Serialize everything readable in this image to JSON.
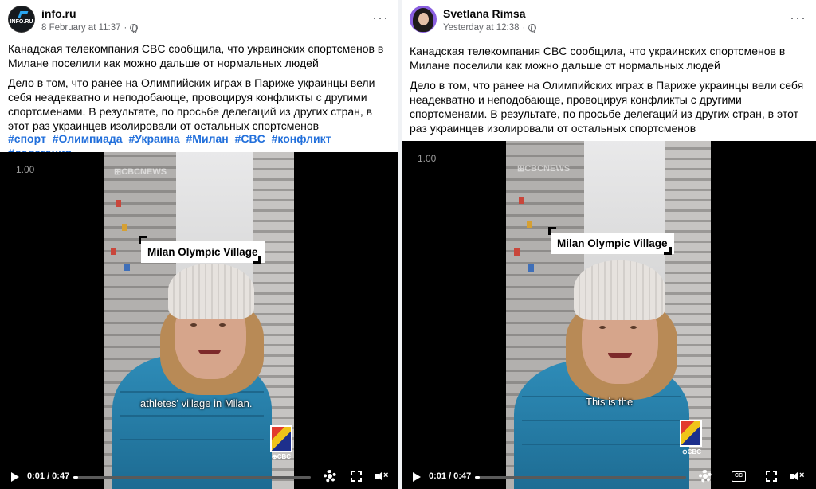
{
  "posts": [
    {
      "author": "info.ru",
      "avatar_text": "INFO.RU",
      "time": "8 February at 11:37",
      "paragraph1": "Канадская телекомпания CBC сообщила, что украинских спортсменов в Милане поселили как можно дальше от нормальных людей",
      "paragraph2": "Дело в том, что ранее на Олимпийских играх в Париже украинцы вели себя неадекватно и неподобающе, провоцируя конфликты с другими спортсменами. В результате, по просьбе делегаций из других стран, в этот раз украинцев изолировали от остальных спортсменов",
      "hashtags": [
        "#спорт",
        "#Олимпиада",
        "#Украина",
        "#Милан",
        "#CBC",
        "#конфликт",
        "#делегация"
      ],
      "video": {
        "rate": "1.00",
        "watermark": "⊞CBCNEWS",
        "location_label": "Milan Olympic Village",
        "subtitle": "athletes' village in Milan.",
        "logo_text": "⊕CBC",
        "time": "0:01 / 0:47",
        "progress": 0.021
      }
    },
    {
      "author": "Svetlana Rimsa",
      "time": "Yesterday at 12:38",
      "paragraph1": "Канадская телекомпания CBC сообщила, что украинских спортсменов в Милане поселили как можно дальше от нормальных людей",
      "paragraph2": "Дело в том, что ранее на Олимпийских играх в Париже украинцы вели себя неадекватно и неподобающе, провоцируя конфликты с другими спортсменами. В результате, по просьбе делегаций из других стран, в этот раз украинцев изолировали от остальных спортсменов",
      "video": {
        "rate": "1.00",
        "watermark": "⊞CBCNEWS",
        "location_label": "Milan Olympic Village",
        "subtitle": "This is the",
        "logo_text": "⊕CBC",
        "time": "0:01 / 0:47",
        "progress": 0.021,
        "cc": "CC"
      }
    }
  ],
  "colors": {
    "hashtag": "#216fdb",
    "meta": "#65676b",
    "jacket": "#2e8cb8"
  }
}
